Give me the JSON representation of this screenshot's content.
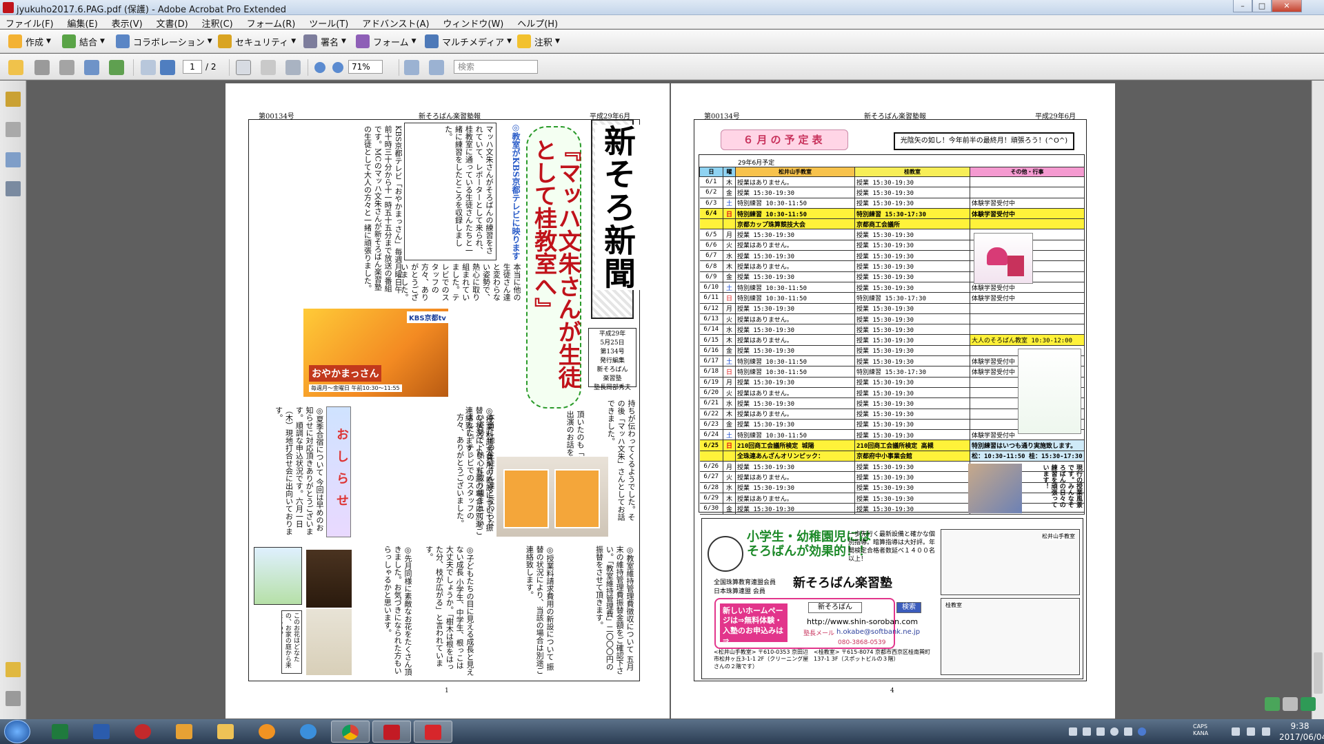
{
  "window": {
    "title": "jyukuho2017.6.PAG.pdf (保護) - Adobe Acrobat Pro Extended",
    "min": "–",
    "max": "□",
    "close": "✕"
  },
  "menu": [
    "ファイル(F)",
    "編集(E)",
    "表示(V)",
    "文書(D)",
    "注釈(C)",
    "フォーム(R)",
    "ツール(T)",
    "アドバンスト(A)",
    "ウィンドウ(W)",
    "ヘルプ(H)"
  ],
  "toolbar": {
    "create": "作成",
    "combine": "結合",
    "collab": "コラボレーション",
    "security": "セキュリティ",
    "sign": "署名",
    "forms": "フォーム",
    "multimedia": "マルチメディア",
    "comment": "注釈"
  },
  "nav": {
    "page_current": "1",
    "page_total": "/ 2",
    "zoom": "71%",
    "search_placeholder": "検索"
  },
  "page1": {
    "issue_no": "第00134号",
    "paper": "新そろばん楽習塾報",
    "date": "平成29年6月",
    "masthead": "新そろ新聞",
    "headline": "『マッハ文朱さんが生徒として桂教室へ』",
    "issue_info": [
      "平成29年",
      "5月25日",
      "第134号",
      "発行編集",
      "新そろばん",
      "楽習塾",
      "塾長岡部秀夫"
    ],
    "lead": "◎教室がKBS京都テレビに映ります",
    "col_a": "マッハ文朱さんがそろばんの練習をされていて、レポーターとして来られ、桂教室に通っている生徒さんたちと一緒に練習をしたところを収録しました。",
    "col_b": "KBS京都テレビ「おやかまっさん」毎週月曜日午前十時三十分から十一時五十五分まで放送の番組です。MCのマッハ文朱さんが新そろばん楽習塾の生徒として大人の方々と一緒に頑張りました。",
    "col_c": "本当に他の生徒さん達と変わらない姿勢で、熱心に取り組まれていました。テレビでのスタッフの方々、ありがとうございました。",
    "col_d": "持ちが伝わってくるようでした。その後「マッハ文朱」さんとしてお話できました。",
    "col_e": "頂いたのも「おやかまっさん」へ出演のお話をさせて頂きました。",
    "oshirase": "おしらせ",
    "notice1": "◎夏季合宿について 今回は早めのお知らせに対応頂きありがとうございます。順調な申込状況です。六月一日（木）現地打合せ会に出向いております。",
    "notice2": "◎教室維持管理費徴収について 五月末の維持管理費振替金額をご確認下さい。「教室維持管理費」二〇〇〇円の振替をさせて頂きます。",
    "notice3": "◎授業料請求費用の新設について 振替の状況により、当該の場合は別途ご連絡致します。",
    "notice4": "◎子どもたちの目に見える成長と見えない成長 小学生、中学生、根っこは大丈夫でしょうか。「樹木は根をはった分、枝が広がる」と言われています。",
    "notice5": "◎先月同様に素敵なお花をたくさん頂きました。お気づきになられた方もいらっしゃるかと思います。",
    "caption_flower": "このお花はどなたの、お家の庭から来たもの？",
    "tv_label": "KBS京都tv",
    "tv_show": "おやかまっさん",
    "tv_time": "毎週月〜金曜日 午前10:30〜11:55",
    "page_no": "1"
  },
  "page4": {
    "issue_no": "第00134号",
    "paper": "新そろばん楽習塾報",
    "date": "平成29年6月",
    "title": "６月の予定表",
    "motto": "光陰矢の如し！今年前半の最終月！頑張ろう！(^O^)",
    "caption": "29年6月予定",
    "headers": [
      "日",
      "曜",
      "松井山手教室",
      "桂教室",
      "その他・行事"
    ],
    "rows": [
      [
        "6/1",
        "木",
        "授業はありません。",
        "授業 15:30-19:30",
        ""
      ],
      [
        "6/2",
        "金",
        "授業 15:30-19:30",
        "授業 15:30-19:30",
        ""
      ],
      [
        "6/3",
        "土",
        "特別練習 10:30-11:50",
        "授業 15:30-19:30",
        "体験学習受付中"
      ],
      [
        "6/4",
        "日",
        "特別練習 10:30-11:50",
        "特別練習 15:30-17:30",
        "体験学習受付中"
      ],
      [
        "",
        "",
        "京都カップ珠算競技大会",
        "京都商工会議所",
        ""
      ],
      [
        "6/5",
        "月",
        "授業 15:30-19:30",
        "授業 15:30-19:30",
        ""
      ],
      [
        "6/6",
        "火",
        "授業はありません。",
        "授業 15:30-19:30",
        ""
      ],
      [
        "6/7",
        "水",
        "授業 15:30-19:30",
        "授業 15:30-19:30",
        ""
      ],
      [
        "6/8",
        "木",
        "授業はありません。",
        "授業 15:30-19:30",
        ""
      ],
      [
        "6/9",
        "金",
        "授業 15:30-19:30",
        "授業 15:30-19:30",
        ""
      ],
      [
        "6/10",
        "土",
        "特別練習 10:30-11:50",
        "授業 15:30-19:30",
        "体験学習受付中"
      ],
      [
        "6/11",
        "日",
        "特別練習 10:30-11:50",
        "特別練習 15:30-17:30",
        "体験学習受付中"
      ],
      [
        "6/12",
        "月",
        "授業 15:30-19:30",
        "授業 15:30-19:30",
        ""
      ],
      [
        "6/13",
        "火",
        "授業はありません。",
        "授業 15:30-19:30",
        ""
      ],
      [
        "6/14",
        "水",
        "授業 15:30-19:30",
        "授業 15:30-19:30",
        ""
      ],
      [
        "6/15",
        "木",
        "授業はありません。",
        "授業 15:30-19:30",
        "大人のそろばん教室 10:30-12:00"
      ],
      [
        "6/16",
        "金",
        "授業 15:30-19:30",
        "授業 15:30-19:30",
        ""
      ],
      [
        "6/17",
        "土",
        "特別練習 10:30-11:50",
        "授業 15:30-19:30",
        "体験学習受付中"
      ],
      [
        "6/18",
        "日",
        "特別練習 10:30-11:50",
        "特別練習 15:30-17:30",
        "体験学習受付中"
      ],
      [
        "6/19",
        "月",
        "授業 15:30-19:30",
        "授業 15:30-19:30",
        ""
      ],
      [
        "6/20",
        "火",
        "授業はありません。",
        "授業 15:30-19:30",
        ""
      ],
      [
        "6/21",
        "水",
        "授業 15:30-19:30",
        "授業 15:30-19:30",
        ""
      ],
      [
        "6/22",
        "木",
        "授業はありません。",
        "授業 15:30-19:30",
        ""
      ],
      [
        "6/23",
        "金",
        "授業 15:30-19:30",
        "授業 15:30-19:30",
        ""
      ],
      [
        "6/24",
        "土",
        "特別練習 10:30-11:50",
        "授業 15:30-19:30",
        "体験学習受付中"
      ],
      [
        "6/25",
        "日",
        "210回商工会議所検定 城陽",
        "210回商工会議所検定 高槻",
        "特別練習はいつも通り実施致します。"
      ],
      [
        "",
        "",
        "全珠連あんざんオリンピック：",
        "京都府中小事業会館",
        "松：10:30-11:50 桂：15:30-17:30"
      ],
      [
        "6/26",
        "月",
        "授業 15:30-19:30",
        "授業 15:30-19:30",
        ""
      ],
      [
        "6/27",
        "火",
        "授業はありません。",
        "授業 15:30-19:30",
        ""
      ],
      [
        "6/28",
        "水",
        "授業 15:30-19:30",
        "授業 15:30-19:30",
        ""
      ],
      [
        "6/29",
        "木",
        "授業はありません。",
        "授業 15:30-19:30",
        ""
      ],
      [
        "6/30",
        "金",
        "授業 15:30-19:30",
        "授業 15:30-19:30",
        ""
      ]
    ],
    "side_note": "現行の授業風景です。みんなそろばんの日々の練習を頑張っています！",
    "ad": {
      "slogan1": "小学生・幼稚園児には",
      "slogan2": "そろばんが効果的！！",
      "points": "一歩先行く最新設備と確かな個別指導。暗算指導は大好評。年間検定合格者数延べ１４００名以上！",
      "assoc1": "全国珠算教育連盟会員",
      "assoc2": "日本珠算連盟 会員",
      "name": "新そろばん楽習塾",
      "pink": "新しいホームページは⇒無料体験・入塾のお申込みは⇒",
      "search_name": "新そろばん",
      "search_btn": "検索",
      "url": "http://www.shin-soroban.com",
      "mail_label": "塾長メール",
      "mail": "h.okabe@softbank.ne.jp",
      "tel": "080-3868-0539",
      "addr1": "<松井山手教室> 〒610-0353 京田辺市松井ヶ丘3-1-1 2F（クリーニング屋さんの２階です）",
      "addr2": "<桂教室> 〒615-8074 京都市西京区桂南巽町137-1 3F（スポットビルの３階）",
      "map1": "松井山手教室",
      "map2": "桂教室"
    },
    "page_no": "4"
  },
  "taskbar": {
    "time": "9:38",
    "date": "2017/06/04",
    "caps": "CAPS",
    "kana": "KANA"
  },
  "colors": {
    "highlight": "#fff23a",
    "pink": "#e2358b",
    "green": "#1e8a2a",
    "red": "#c0121a"
  }
}
